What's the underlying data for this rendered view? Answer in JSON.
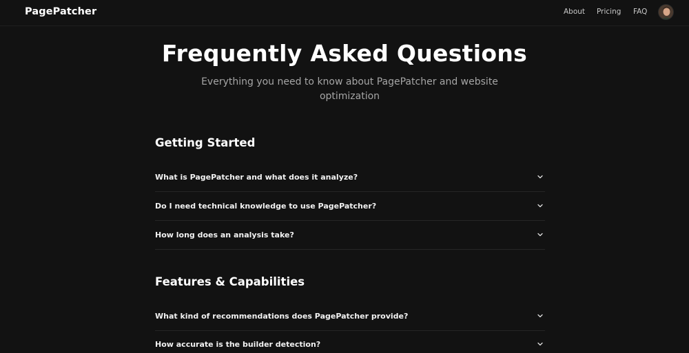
{
  "nav": {
    "brand": "PagePatcher",
    "links": [
      "About",
      "Pricing",
      "FAQ"
    ]
  },
  "hero": {
    "title": "Frequently Asked Questions",
    "subtitle": "Everything you need to know about PagePatcher and website optimization"
  },
  "sections": [
    {
      "heading": "Getting Started",
      "questions": [
        "What is PagePatcher and what does it analyze?",
        "Do I need technical knowledge to use PagePatcher?",
        "How long does an analysis take?"
      ]
    },
    {
      "heading": "Features & Capabilities",
      "questions": [
        "What kind of recommendations does PagePatcher provide?",
        "How accurate is the builder detection?"
      ]
    }
  ],
  "colors": {
    "background": "#121212",
    "text": "#ffffff",
    "muted": "#a6a6a6",
    "divider": "#262626"
  },
  "icons": {
    "avatar": "user-avatar",
    "chevron": "chevron-down-icon"
  }
}
